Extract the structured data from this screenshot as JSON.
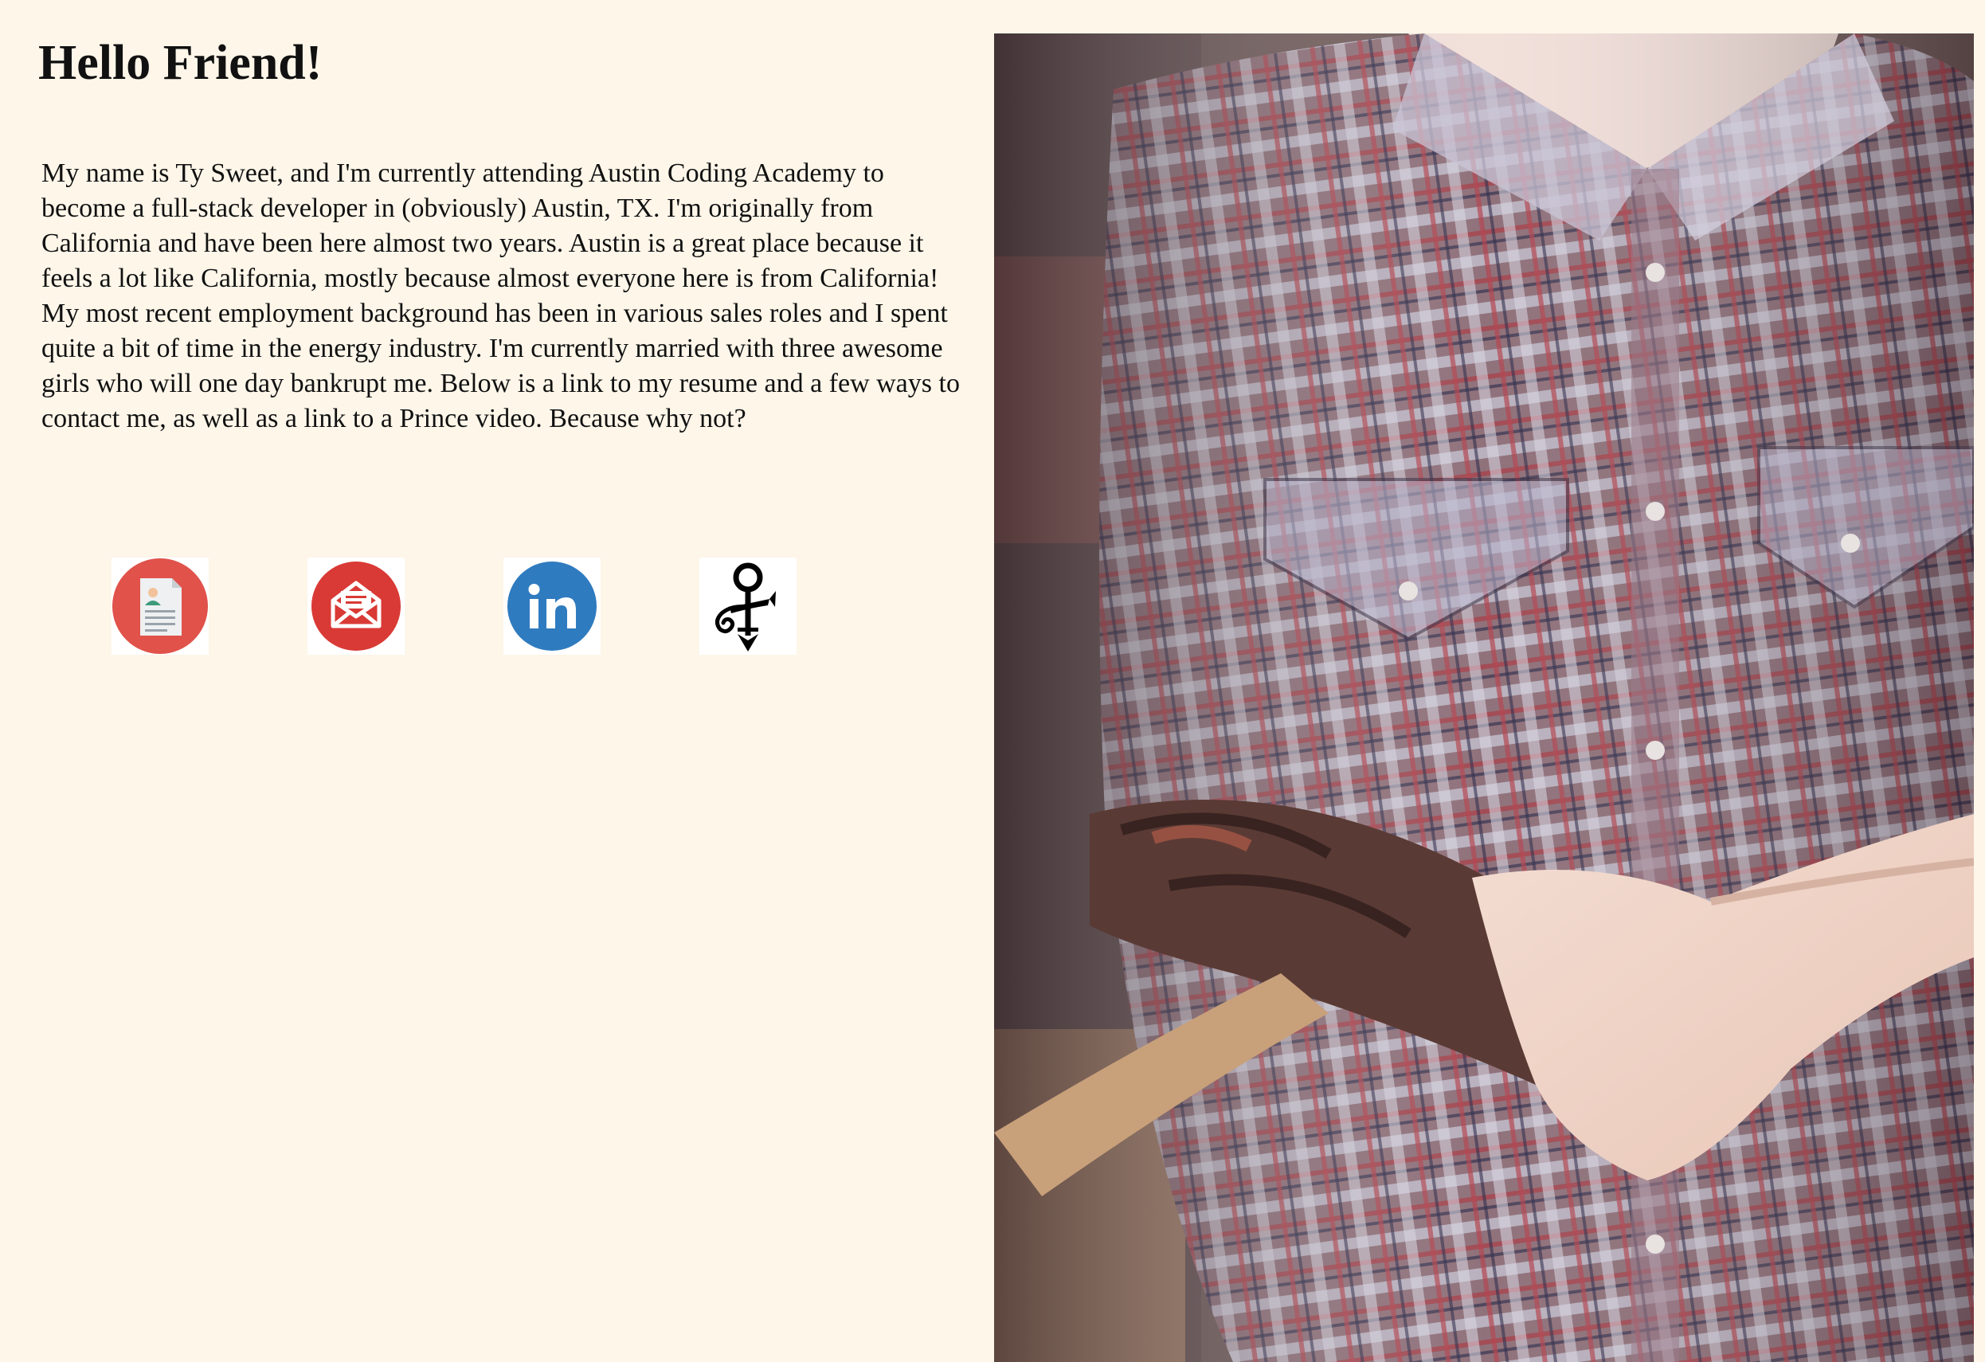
{
  "heading": "Hello Friend!",
  "bio": "My name is Ty Sweet, and I'm currently attending Austin Coding Academy to become a full-stack developer in (obviously) Austin, TX. I'm originally from California and have been here almost two years. Austin is a great place because it feels a lot like California, mostly because almost everyone here is from California! My most recent employment background has been in various sales roles and I spent quite a bit of time in the energy industry. I'm currently married with three awesome girls who will one day bankrupt me. Below is a link to my resume and a few ways to contact me, as well as a link to a Prince video. Because why not?",
  "links": [
    {
      "icon": "resume-icon",
      "color": "#e0524a"
    },
    {
      "icon": "email-icon",
      "color": "#d93a35"
    },
    {
      "icon": "linkedin-icon",
      "color": "#2f7bbf"
    },
    {
      "icon": "prince-symbol-icon",
      "color": "#000000"
    }
  ],
  "colors": {
    "background": "#fdf6e9",
    "text": "#111111"
  }
}
